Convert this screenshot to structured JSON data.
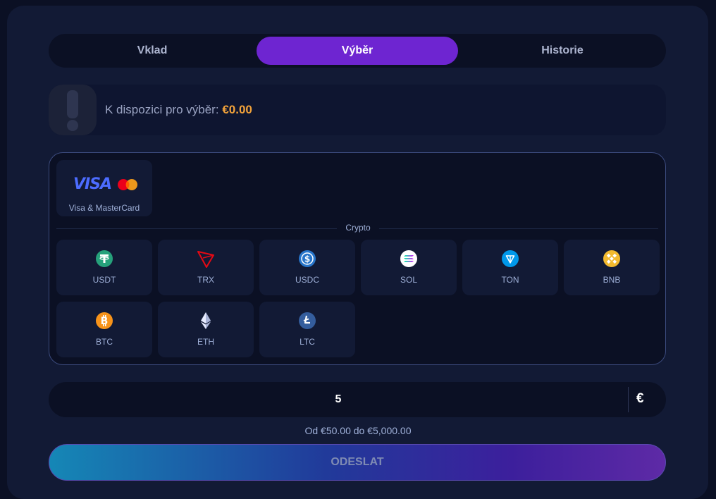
{
  "tabs": [
    {
      "label": "Vklad"
    },
    {
      "label": "Výběr"
    },
    {
      "label": "Historie"
    }
  ],
  "available": {
    "label": "K dispozici pro výběr:",
    "amount": "€0.00"
  },
  "methods": {
    "card": {
      "logo_text": "VISA",
      "label": "Visa & MasterCard"
    },
    "crypto_title": "Crypto",
    "crypto": [
      {
        "label": "USDT",
        "icon": "tether-icon",
        "color": "#26a17b"
      },
      {
        "label": "TRX",
        "icon": "tron-icon",
        "color": "#e50914"
      },
      {
        "label": "USDC",
        "icon": "usdc-icon",
        "color": "#2775ca"
      },
      {
        "label": "SOL",
        "icon": "solana-icon",
        "color": "#9945ff"
      },
      {
        "label": "TON",
        "icon": "ton-icon",
        "color": "#0098ea"
      },
      {
        "label": "BNB",
        "icon": "bnb-icon",
        "color": "#f3ba2f"
      },
      {
        "label": "BTC",
        "icon": "bitcoin-icon",
        "color": "#f7931a"
      },
      {
        "label": "ETH",
        "icon": "ethereum-icon",
        "color": "#c8d1ee"
      },
      {
        "label": "LTC",
        "icon": "litecoin-icon",
        "color": "#345d9d"
      }
    ]
  },
  "amount": {
    "value": "5",
    "currency": "€"
  },
  "range_text": "Od €50.00 do €5,000.00",
  "submit_label": "ODESLAT",
  "colors": {
    "accent": "#6e25d1",
    "highlight": "#f3a33a"
  }
}
